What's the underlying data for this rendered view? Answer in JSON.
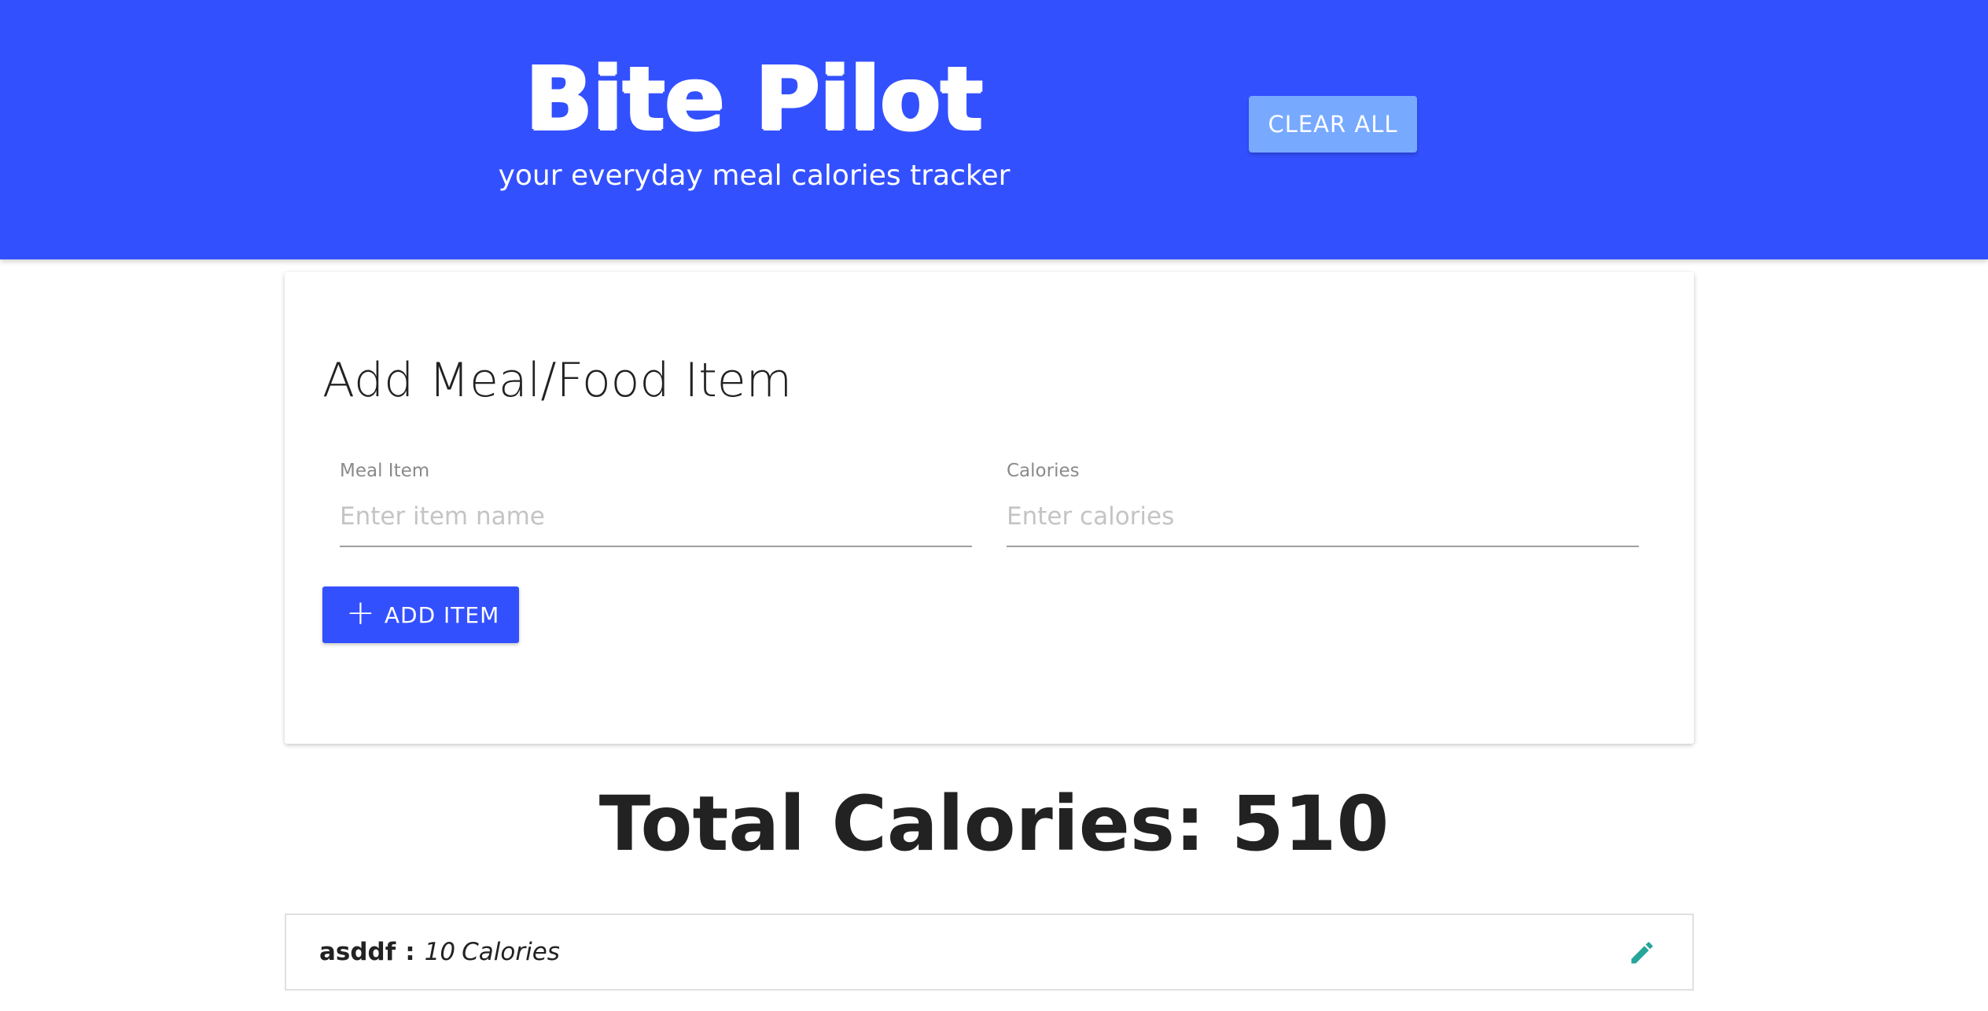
{
  "header": {
    "title": "Bite Pilot",
    "subtitle": "your everyday meal calories tracker",
    "clear_all_label": "CLEAR ALL",
    "background_color": "#3350ff",
    "clear_all_color": "#77a9ff"
  },
  "form": {
    "title": "Add Meal/Food Item",
    "meal_item": {
      "label": "Meal Item",
      "placeholder": "Enter item name",
      "value": ""
    },
    "calories": {
      "label": "Calories",
      "placeholder": "Enter calories",
      "value": ""
    },
    "add_button": {
      "icon": "plus-icon",
      "label": "ADD ITEM"
    }
  },
  "total": {
    "label": "Total Calories: 510"
  },
  "items": [
    {
      "name": "asddf",
      "separator": ":",
      "calories": "10",
      "unit": "Calories",
      "edit_icon": "pencil-icon",
      "edit_icon_color": "#26a69a"
    }
  ]
}
